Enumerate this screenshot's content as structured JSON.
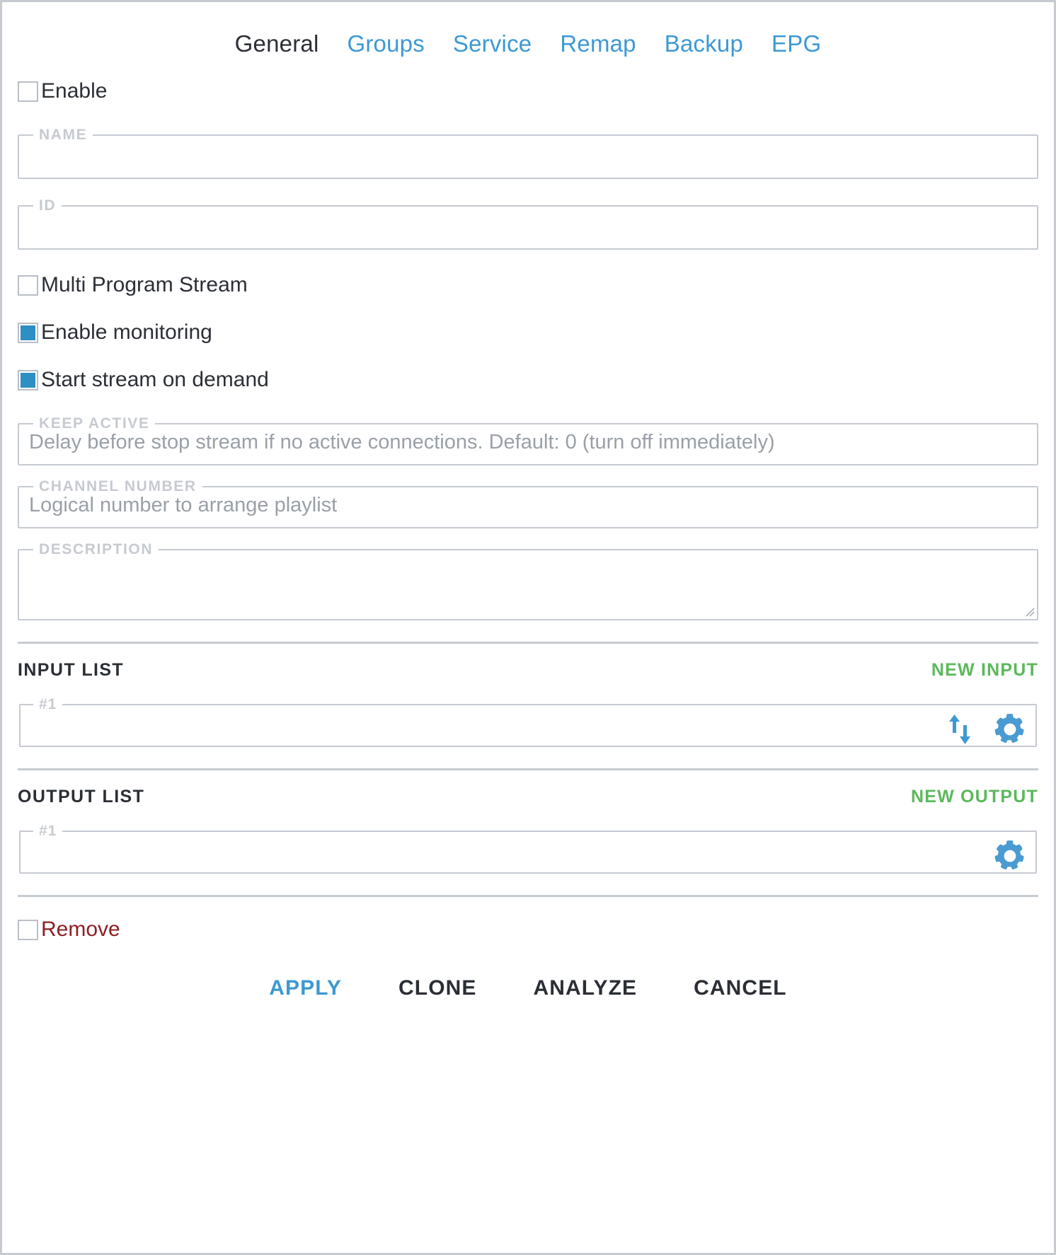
{
  "colors": {
    "accent_blue": "#3d99d3",
    "checkbox_blue": "#2e8fc4",
    "green_action": "#5cb85c",
    "danger_red": "#8d2023",
    "border_gray": "#c6cad1",
    "text_dark": "#2b2f35",
    "placeholder_gray": "#9aa0a8"
  },
  "tabs": [
    {
      "label": "General",
      "active": true
    },
    {
      "label": "Groups",
      "active": false
    },
    {
      "label": "Service",
      "active": false
    },
    {
      "label": "Remap",
      "active": false
    },
    {
      "label": "Backup",
      "active": false
    },
    {
      "label": "EPG",
      "active": false
    }
  ],
  "checkboxes": {
    "enable": {
      "label": "Enable",
      "checked": false
    },
    "multi_program_stream": {
      "label": "Multi Program Stream",
      "checked": false
    },
    "enable_monitoring": {
      "label": "Enable monitoring",
      "checked": true
    },
    "start_stream_on_demand": {
      "label": "Start stream on demand",
      "checked": true
    },
    "remove": {
      "label": "Remove",
      "checked": false
    }
  },
  "fields": {
    "name": {
      "legend": "NAME",
      "value": "",
      "placeholder": ""
    },
    "id": {
      "legend": "ID",
      "value": "",
      "placeholder": ""
    },
    "keep_active": {
      "legend": "KEEP ACTIVE",
      "value": "",
      "placeholder": "Delay before stop stream if no active connections. Default: 0 (turn off immediately)"
    },
    "channel_number": {
      "legend": "CHANNEL NUMBER",
      "value": "",
      "placeholder": "Logical number to arrange playlist"
    },
    "description": {
      "legend": "DESCRIPTION",
      "value": "",
      "placeholder": ""
    }
  },
  "input_list": {
    "title": "INPUT LIST",
    "action_label": "NEW INPUT",
    "rows": [
      {
        "legend": "#1",
        "value": "",
        "icons": [
          "swap-vertical-arrows-icon",
          "gear-icon"
        ]
      }
    ]
  },
  "output_list": {
    "title": "OUTPUT LIST",
    "action_label": "NEW OUTPUT",
    "rows": [
      {
        "legend": "#1",
        "value": "",
        "icons": [
          "gear-icon"
        ]
      }
    ]
  },
  "footer_buttons": [
    {
      "label": "APPLY",
      "primary": true
    },
    {
      "label": "CLONE",
      "primary": false
    },
    {
      "label": "ANALYZE",
      "primary": false
    },
    {
      "label": "CANCEL",
      "primary": false
    }
  ]
}
